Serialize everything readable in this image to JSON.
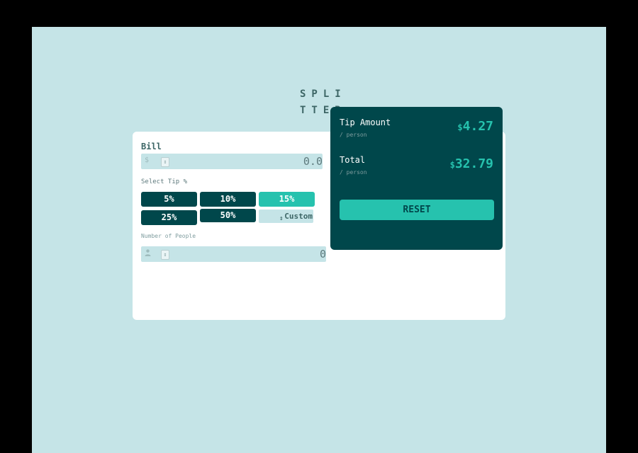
{
  "app": {
    "logo_line1": "SPLI",
    "logo_line2": "TTER"
  },
  "calculator": {
    "bill": {
      "label": "Bill",
      "currency_icon": "dollar-icon",
      "prefix_glyph": "$",
      "value": "0.0"
    },
    "tip": {
      "label": "Select Tip %",
      "options": [
        "5%",
        "10%",
        "15%",
        "25%",
        "50%"
      ],
      "selected": "15%",
      "custom_placeholder": "Custom"
    },
    "people": {
      "label": "Number of People",
      "person_icon": "person-icon",
      "value": "0"
    }
  },
  "results": {
    "tip_amount": {
      "title": "Tip Amount",
      "subtitle": "/ person",
      "currency": "$",
      "value": "4.27"
    },
    "total": {
      "title": "Total",
      "subtitle": "/ person",
      "currency": "$",
      "value": "32.79"
    },
    "reset_label": "RESET"
  },
  "colors": {
    "background": "#c5e4e7",
    "card": "#ffffff",
    "dark_teal": "#00474b",
    "accent": "#26c2ae",
    "muted": "#5e7a7d"
  }
}
